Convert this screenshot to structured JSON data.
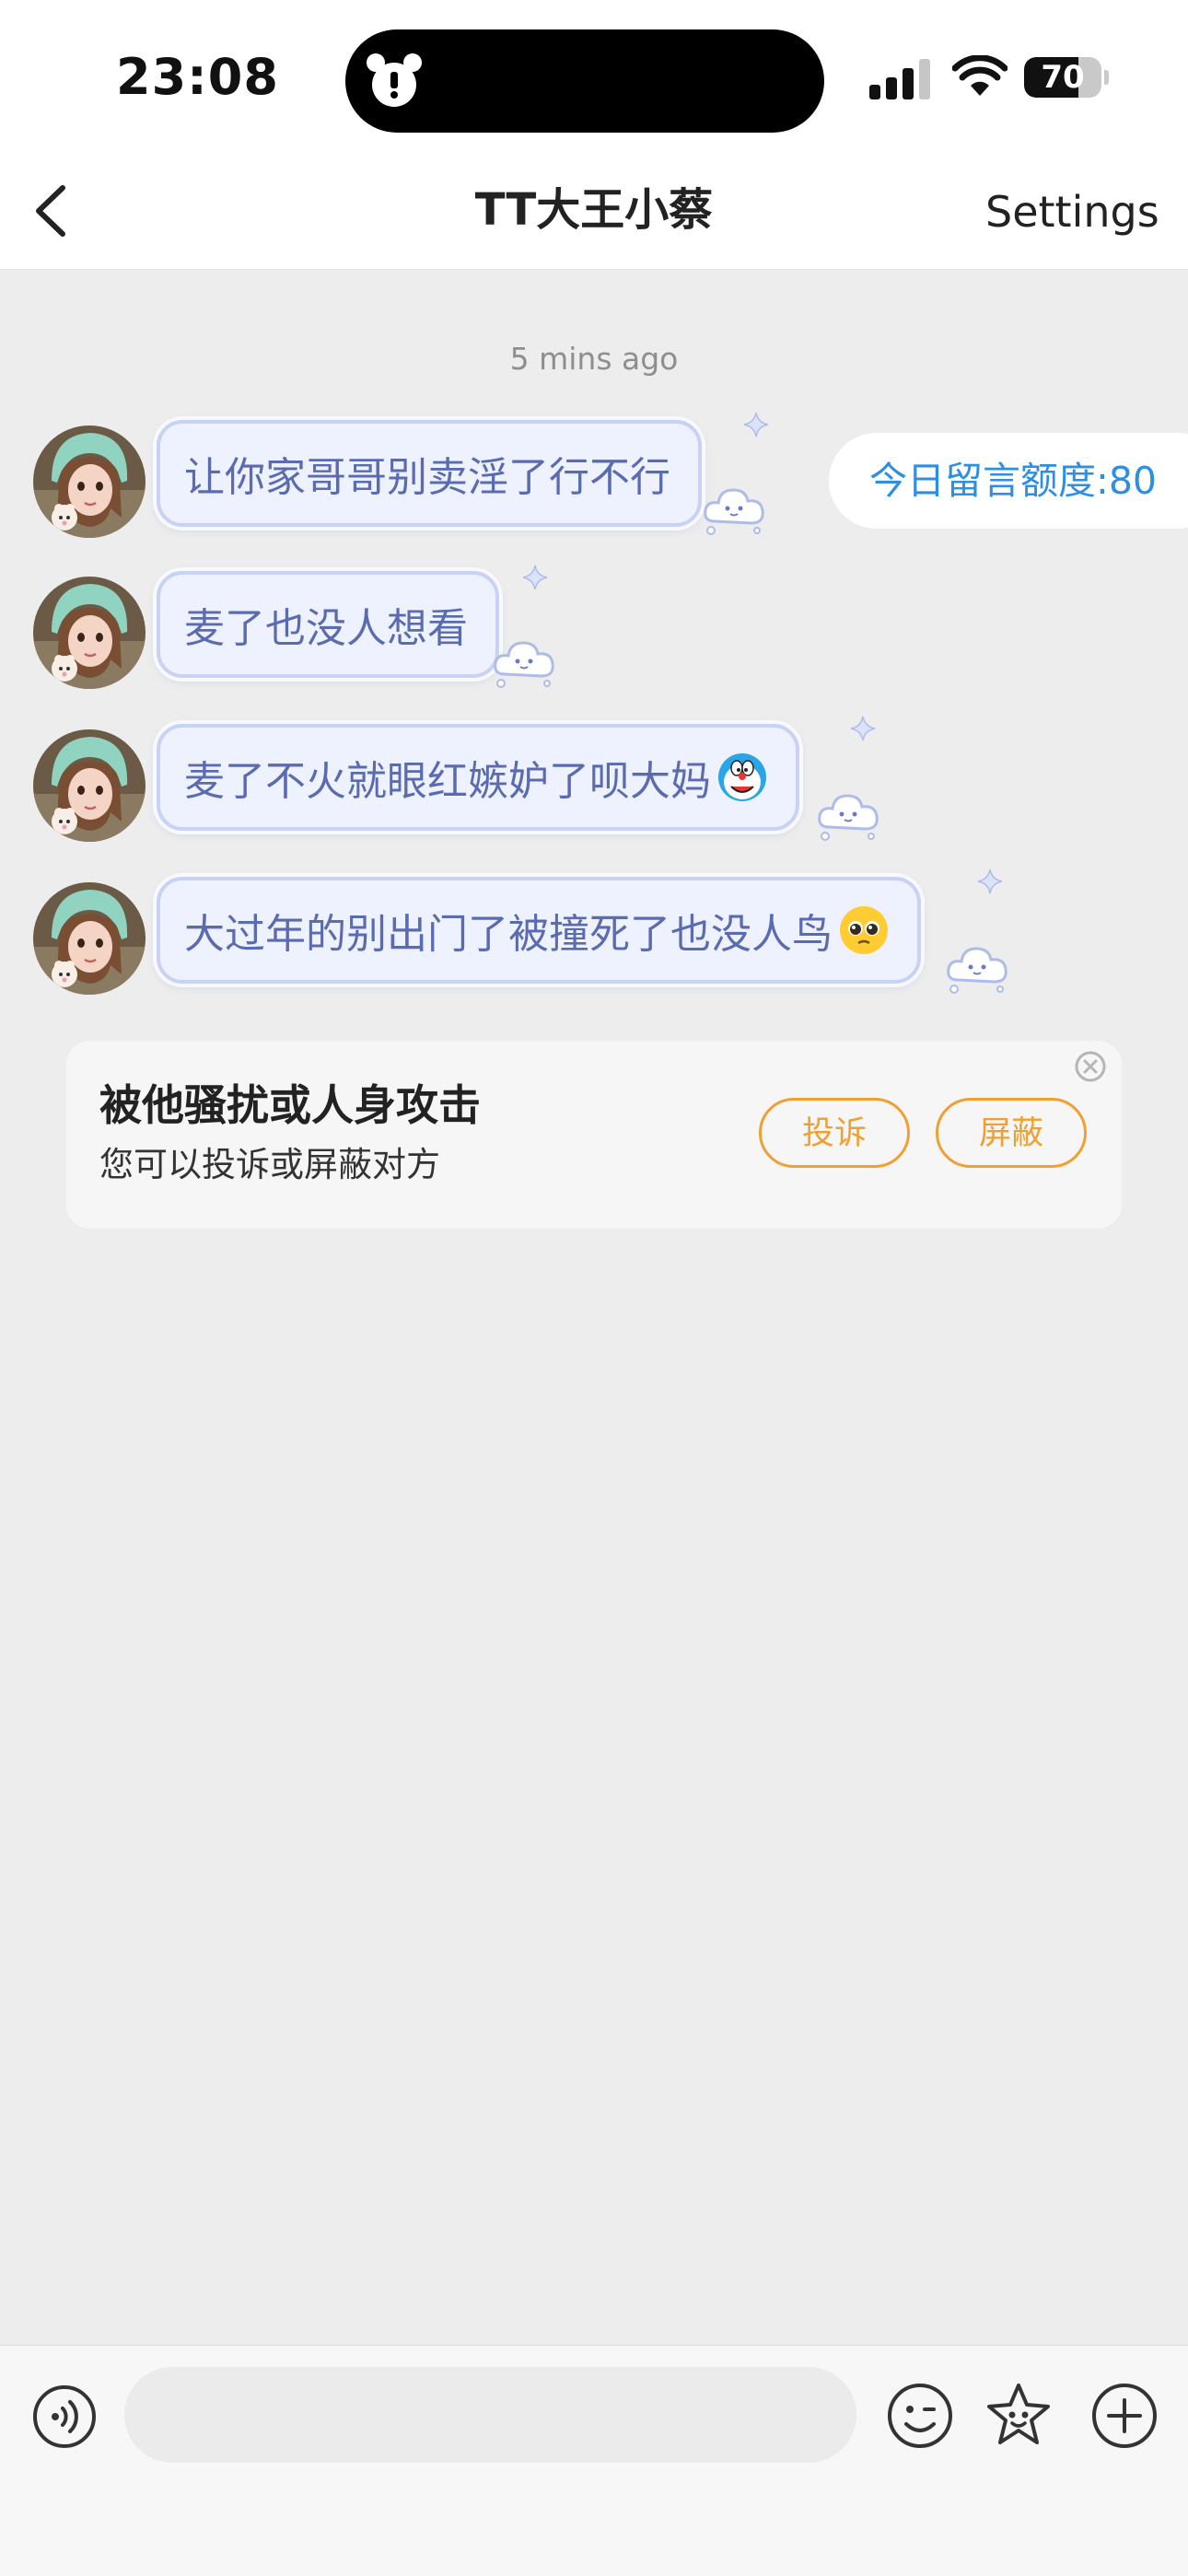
{
  "status_bar": {
    "time": "23:08",
    "battery": "70",
    "battery_level": 0.7
  },
  "nav": {
    "back_icon": "chevron-left-icon",
    "title": "TT大王小蔡",
    "settings_label": "Settings"
  },
  "chat": {
    "timestamp": "5 mins ago",
    "quota_label": "今日留言额度:80",
    "messages": [
      {
        "text": "让你家哥哥别卖淫了行不行"
      },
      {
        "text": "麦了也没人想看"
      },
      {
        "text": "麦了不火就眼红嫉妒了呗大妈",
        "emoji": "doraemon-emoji"
      },
      {
        "text": "大过年的别出门了被撞死了也没人鸟",
        "emoji": "pleading-face-emoji"
      }
    ]
  },
  "notice": {
    "title": "被他骚扰或人身攻击",
    "subtitle": "您可以投诉或屏蔽对方",
    "report_label": "投诉",
    "block_label": "屏蔽"
  },
  "input_bar": {
    "placeholder": "",
    "icons": [
      "voice-icon",
      "emoji-icon",
      "sticker-icon",
      "plus-icon"
    ]
  },
  "colors": {
    "accent_blue": "#2e8fe0",
    "bubble_text": "#5b6bb0",
    "bubble_border": "#c7d2f5",
    "warning_orange": "#f0a033"
  }
}
